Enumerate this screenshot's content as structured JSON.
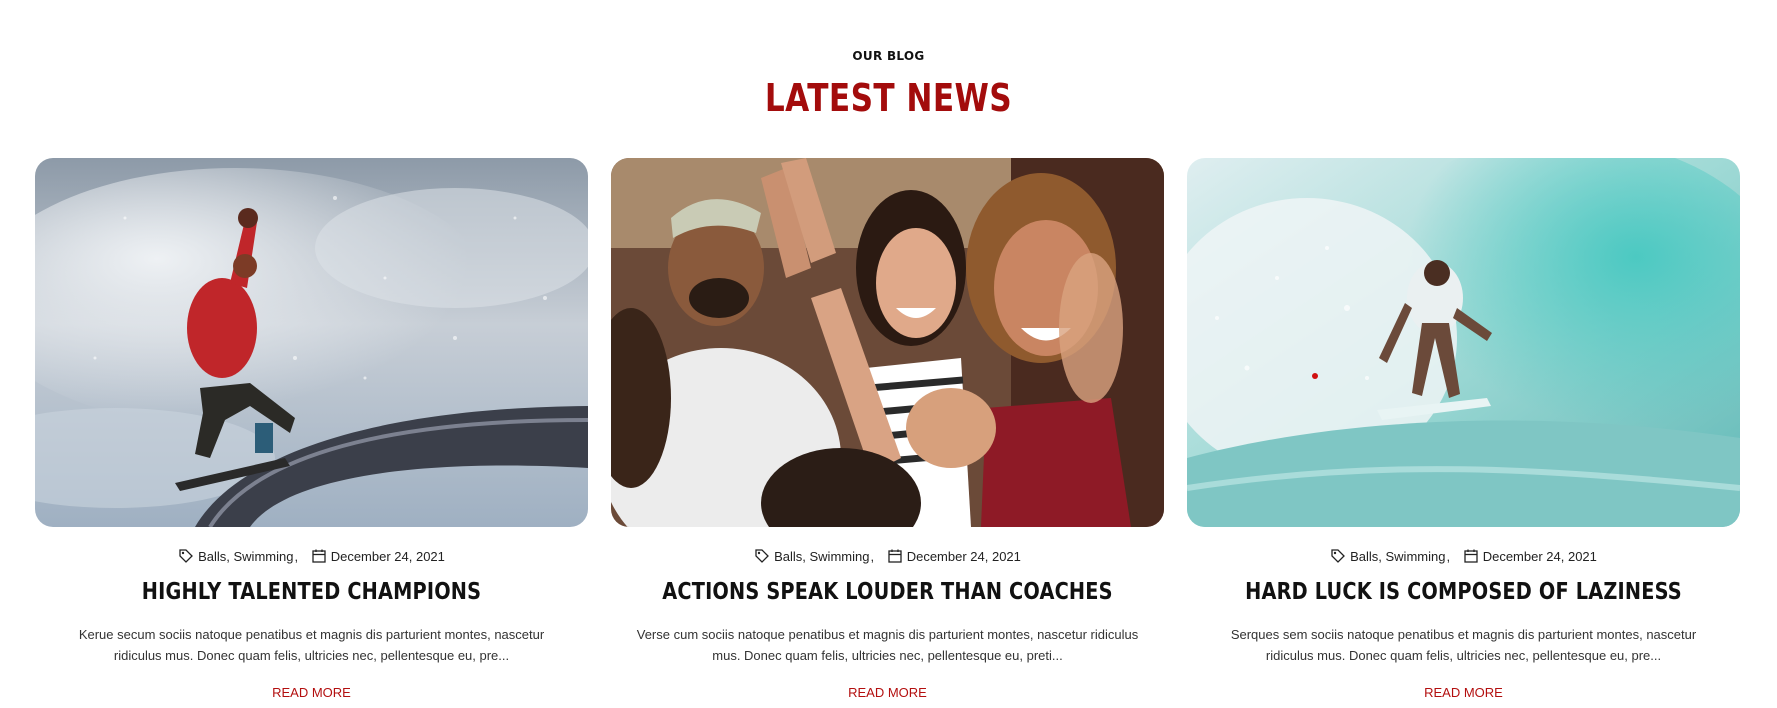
{
  "section": {
    "eyebrow": "OUR BLOG",
    "heading": "LATEST NEWS",
    "accent_color": "#a30c0c"
  },
  "posts": [
    {
      "image_alt": "Snowboarder grinding a rail against a cloudy sky",
      "categories": "Balls, Swimming",
      "date": "December 24, 2021",
      "title": "HIGHLY TALENTED CHAMPIONS",
      "excerpt": "Kerue secum sociis natoque penatibus et magnis dis parturient montes, nascetur ridiculus mus. Donec quam felis, ultricies nec, pellentesque eu, pre...",
      "read_more": "READ MORE"
    },
    {
      "image_alt": "Cheering fans clapping in a stadium crowd",
      "categories": "Balls, Swimming",
      "date": "December 24, 2021",
      "title": "ACTIONS SPEAK LOUDER THAN COACHES",
      "excerpt": "Verse cum sociis natoque penatibus et magnis dis parturient montes, nascetur ridiculus mus. Donec quam felis, ultricies nec, pellentesque eu, preti...",
      "read_more": "READ MORE"
    },
    {
      "image_alt": "Surfer riding inside a turquoise wave",
      "categories": "Balls, Swimming",
      "date": "December 24, 2021",
      "title": "HARD LUCK IS COMPOSED OF LAZINESS",
      "excerpt": "Serques sem sociis natoque penatibus et magnis dis parturient montes, nascetur ridiculus mus. Donec quam felis, ultricies nec, pellentesque eu, pre...",
      "read_more": "READ MORE"
    }
  ],
  "icons": {
    "category": "tag-icon",
    "date": "calendar-icon"
  }
}
